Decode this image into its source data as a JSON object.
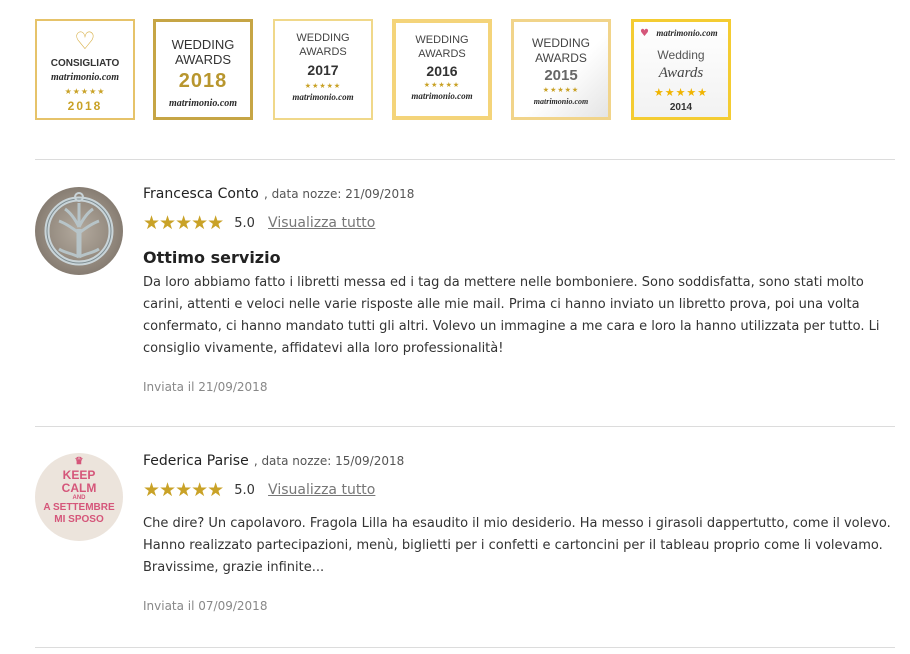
{
  "badges": [
    {
      "line1": "CONSIGLIATO",
      "brand": "matrimonio.com",
      "stars": "★★★★★",
      "year": "2018",
      "heart": "♡"
    },
    {
      "line1": "WEDDING",
      "line2": "AWARDS",
      "year": "2018",
      "brand": "matrimonio.com"
    },
    {
      "line1": "WEDDING",
      "line2": "AWARDS",
      "year": "2017",
      "stars": "★★★★★",
      "brand": "matrimonio.com"
    },
    {
      "line1": "WEDDING",
      "line2": "AWARDS",
      "year": "2016",
      "stars": "★★★★★",
      "brand": "matrimonio.com"
    },
    {
      "line1": "WEDDING",
      "line2": "AWARDS",
      "year": "2015",
      "stars": "★★★★★",
      "brand": "matrimonio.com"
    },
    {
      "brand": "matrimonio.com",
      "line1": "Wedding",
      "line2": "Awards",
      "stars": "★★★★★",
      "year": "2014",
      "heart": "♥"
    }
  ],
  "reviews": [
    {
      "author": "Francesca Conto",
      "date_label": ", data nozze: 21/09/2018",
      "stars": "★★★★★",
      "score": "5.0",
      "view_all": "Visualizza tutto",
      "title": "Ottimo servizio",
      "body": "Da loro abbiamo fatto i libretti messa ed i tag da mettere nelle bomboniere. Sono soddisfatta, sono stati molto carini, attenti e veloci nelle varie risposte alle mie mail. Prima ci hanno inviato un libretto prova, poi una volta confermato, ci hanno mandato tutti gli altri. Volevo un immagine a me cara e loro la hanno utilizzata per tutto. Li consiglio vivamente, affidatevi alla loro professionalità!",
      "sent": "Inviata il 21/09/2018"
    },
    {
      "author": "Federica Parise",
      "date_label": ", data nozze: 15/09/2018",
      "stars": "★★★★★",
      "score": "5.0",
      "view_all": "Visualizza tutto",
      "body": "Che dire? Un capolavoro. Fragola Lilla ha esaudito il mio desiderio. Ha messo i girasoli dappertutto, come il volevo. Hanno realizzato partecipazioni, menù, biglietti per i confetti e cartoncini per il tableau proprio come li volevamo. Bravissime, grazie infinite...",
      "sent": "Inviata il 07/09/2018",
      "avatar_text": {
        "l1": "KEEP",
        "l2": "CALM",
        "l3": "AND",
        "l4": "A SETTEMBRE",
        "l5": "MI SPOSO"
      }
    }
  ],
  "colors": {
    "gold": "#c9a227",
    "badge_border": "#e8c86a",
    "accent_pink": "#d5567a"
  }
}
